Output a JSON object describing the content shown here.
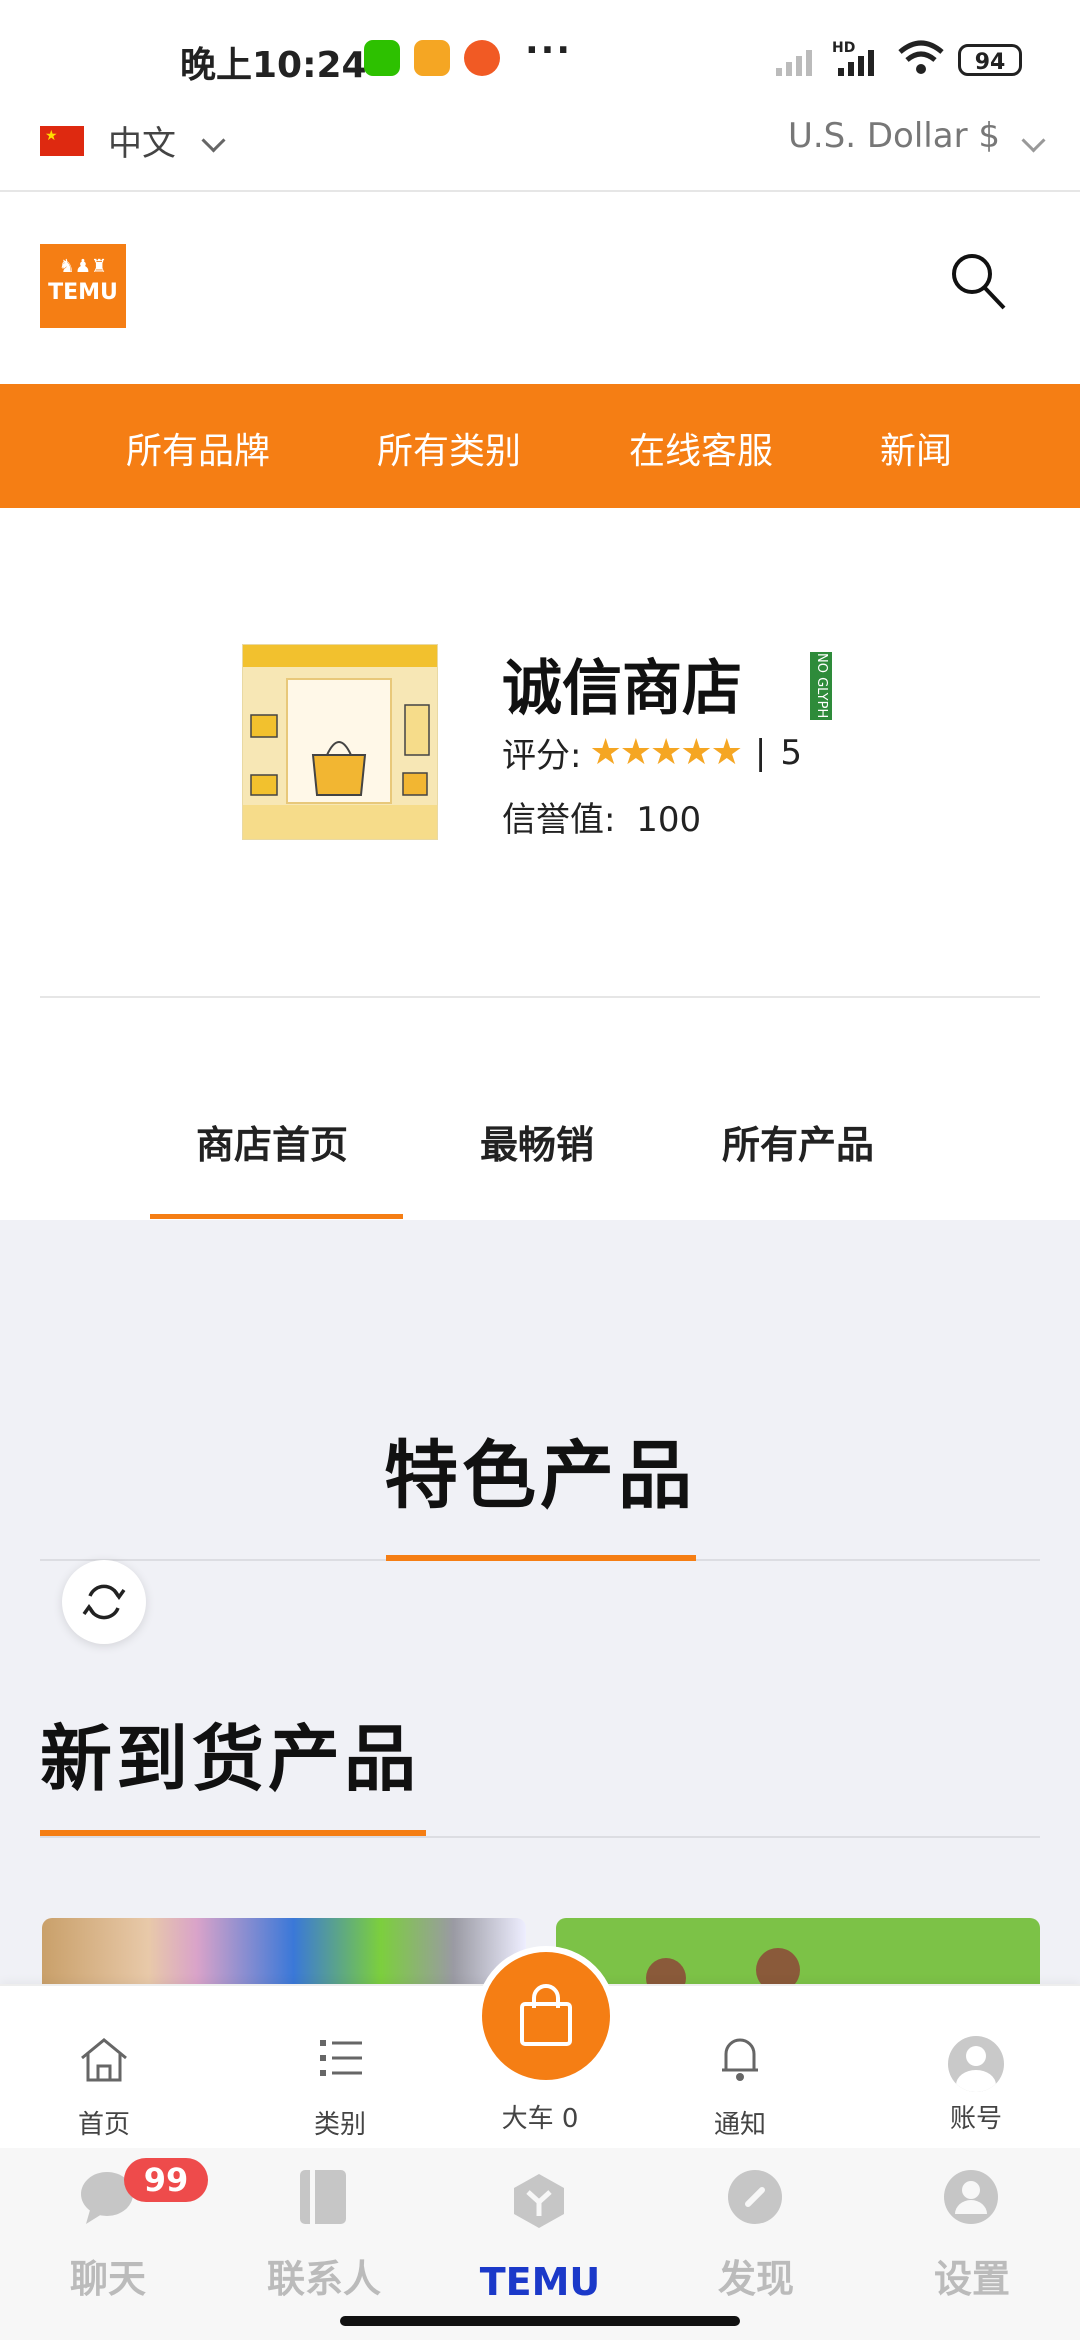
{
  "status_bar": {
    "time": "晚上10:24",
    "more": "···",
    "network": "HD",
    "battery": "94"
  },
  "language": {
    "flag": "china-flag",
    "label": "中文",
    "currency": "U.S. Dollar $"
  },
  "header": {
    "logo_text": "TEMU"
  },
  "nav": {
    "items": [
      "所有品牌",
      "所有类别",
      "在线客服",
      "新闻"
    ]
  },
  "store": {
    "name": "诚信商店",
    "badge": "NO GLYPH",
    "rating_label": "评分:",
    "rating_separator": "|",
    "rating_value": "5",
    "stars": 5,
    "reputation_label": "信誉值:",
    "reputation_value": "100"
  },
  "tabs": {
    "items": [
      "商店首页",
      "最畅销",
      "所有产品"
    ],
    "active_index": 0
  },
  "sections": {
    "featured_title": "特色产品",
    "new_arrivals_title": "新到货产品"
  },
  "shop_bar": {
    "home": "首页",
    "categories": "类别",
    "cart": "大车 0",
    "notifications": "通知",
    "account": "账号"
  },
  "app_tabs": {
    "chat": "聊天",
    "contacts": "联系人",
    "temu": "TEMU",
    "discover": "发现",
    "settings": "设置",
    "chat_badge": "99"
  },
  "colors": {
    "accent": "#f57e14",
    "active_tab_blue": "#1b39c9",
    "badge_red": "#ee4b4b"
  }
}
